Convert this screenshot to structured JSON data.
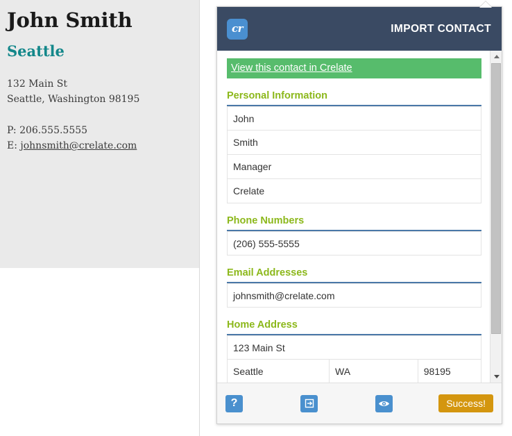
{
  "left_pane": {
    "name": "John Smith",
    "city_headline": "Seattle",
    "address_line1": "132 Main St",
    "address_line2": "Seattle, Washington 98195",
    "phone_line": "P: 206.555.5555",
    "email_prefix": "E: ",
    "email": "johnsmith@crelate.com"
  },
  "popup": {
    "logo_text": "cr",
    "title": "IMPORT CONTACT",
    "view_link": "View this contact in Crelate",
    "sections": [
      {
        "heading": "Personal Information",
        "rows": [
          {
            "cells": [
              {
                "value": "John"
              }
            ]
          },
          {
            "cells": [
              {
                "value": "Smith"
              }
            ]
          },
          {
            "cells": [
              {
                "value": "Manager"
              }
            ]
          },
          {
            "cells": [
              {
                "value": "Crelate"
              }
            ]
          }
        ]
      },
      {
        "heading": "Phone Numbers",
        "rows": [
          {
            "cells": [
              {
                "value": "(206) 555-5555"
              }
            ]
          }
        ]
      },
      {
        "heading": "Email Addresses",
        "rows": [
          {
            "cells": [
              {
                "value": "johnsmith@crelate.com"
              }
            ]
          }
        ]
      },
      {
        "heading": "Home Address",
        "rows": [
          {
            "cells": [
              {
                "value": "123 Main St"
              }
            ]
          },
          {
            "cells": [
              {
                "value": "Seattle"
              },
              {
                "value": "WA"
              },
              {
                "value": "98195"
              }
            ]
          }
        ]
      }
    ],
    "footer": {
      "help_icon": "?",
      "signin_icon": "sign-in",
      "preview_icon": "eye",
      "status_label": "Success!"
    }
  },
  "colors": {
    "header_bg": "#3a4a63",
    "logo_blue": "#4a8fd0",
    "link_green": "#57bc6c",
    "section_green": "#8cb81b",
    "section_rule": "#4a78a8",
    "teal": "#13878a",
    "icon_blue": "#4a90ce",
    "success_orange": "#d4960f"
  }
}
